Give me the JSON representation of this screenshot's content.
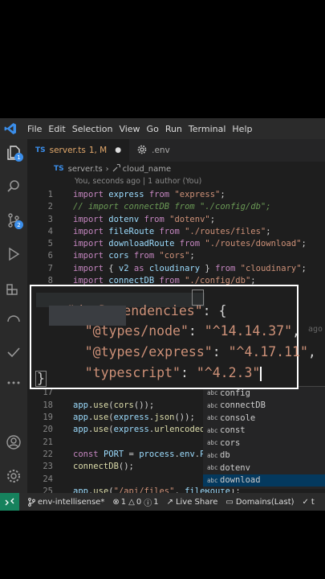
{
  "menubar": {
    "items": [
      "File",
      "Edit",
      "Selection",
      "View",
      "Go",
      "Run",
      "Terminal",
      "Help"
    ]
  },
  "tabs": [
    {
      "icon": "TS",
      "label": "server.ts",
      "status": "1, M"
    },
    {
      "label": ".env"
    }
  ],
  "breadcrumb": {
    "file_icon": "TS",
    "file": "server.ts",
    "symbol": "cloud_name"
  },
  "codelens": "You, seconds ago | 1 author (You)",
  "code_lines": [
    {
      "n": "1",
      "t": [
        [
          "kw",
          "import "
        ],
        [
          "id",
          "express "
        ],
        [
          "kw",
          "from "
        ],
        [
          "str",
          "\"express\""
        ],
        [
          "pl",
          ";"
        ]
      ]
    },
    {
      "n": "2",
      "t": [
        [
          "cm",
          "// import connectDB from \"./config/db\";"
        ]
      ]
    },
    {
      "n": "3",
      "t": [
        [
          "kw",
          "import "
        ],
        [
          "id",
          "dotenv "
        ],
        [
          "kw",
          "from "
        ],
        [
          "str",
          "\"dotenv\""
        ],
        [
          "pl",
          ";"
        ]
      ]
    },
    {
      "n": "4",
      "t": [
        [
          "kw",
          "import "
        ],
        [
          "id",
          "fileRoute "
        ],
        [
          "kw",
          "from "
        ],
        [
          "str",
          "\"./routes/files\""
        ],
        [
          "pl",
          ";"
        ]
      ]
    },
    {
      "n": "5",
      "t": [
        [
          "kw",
          "import "
        ],
        [
          "id",
          "downloadRoute "
        ],
        [
          "kw",
          "from "
        ],
        [
          "str",
          "\"./routes/download\""
        ],
        [
          "pl",
          ";"
        ]
      ]
    },
    {
      "n": "6",
      "t": [
        [
          "kw",
          "import "
        ],
        [
          "id",
          "cors "
        ],
        [
          "kw",
          "from "
        ],
        [
          "str",
          "\"cors\""
        ],
        [
          "pl",
          ";"
        ]
      ]
    },
    {
      "n": "7",
      "t": [
        [
          "kw",
          "import "
        ],
        [
          "pl",
          "{ "
        ],
        [
          "id",
          "v2 "
        ],
        [
          "kw",
          "as "
        ],
        [
          "id",
          "cloudinary "
        ],
        [
          "pl",
          "} "
        ],
        [
          "kw",
          "from "
        ],
        [
          "str",
          "\"cloudinary\""
        ],
        [
          "pl",
          ";"
        ]
      ]
    },
    {
      "n": "8",
      "t": [
        [
          "kw",
          "import "
        ],
        [
          "id",
          "connectDB "
        ],
        [
          "kw",
          "from "
        ],
        [
          "str",
          "\"./config/db\""
        ],
        [
          "pl",
          ";"
        ]
      ]
    },
    {
      "n": "17",
      "t": [
        [
          "pl",
          ""
        ]
      ]
    },
    {
      "n": "18",
      "t": [
        [
          "id",
          "app"
        ],
        [
          "pl",
          "."
        ],
        [
          "fn",
          "use"
        ],
        [
          "pl",
          "("
        ],
        [
          "fn",
          "cors"
        ],
        [
          "pl",
          "());"
        ]
      ]
    },
    {
      "n": "19",
      "t": [
        [
          "id",
          "app"
        ],
        [
          "pl",
          "."
        ],
        [
          "fn",
          "use"
        ],
        [
          "pl",
          "("
        ],
        [
          "id",
          "express"
        ],
        [
          "pl",
          "."
        ],
        [
          "fn",
          "json"
        ],
        [
          "pl",
          "());"
        ]
      ]
    },
    {
      "n": "20",
      "t": [
        [
          "id",
          "app"
        ],
        [
          "pl",
          "."
        ],
        [
          "fn",
          "use"
        ],
        [
          "pl",
          "("
        ],
        [
          "id",
          "express"
        ],
        [
          "pl",
          "."
        ],
        [
          "fn",
          "urlencoded"
        ]
      ]
    },
    {
      "n": "21",
      "t": [
        [
          "pl",
          ""
        ]
      ]
    },
    {
      "n": "22",
      "t": [
        [
          "kw",
          "const "
        ],
        [
          "id",
          "PORT "
        ],
        [
          "pl",
          "= "
        ],
        [
          "id",
          "process"
        ],
        [
          "pl",
          "."
        ],
        [
          "id",
          "env"
        ],
        [
          "pl",
          "."
        ],
        [
          "id",
          "P"
        ]
      ]
    },
    {
      "n": "23",
      "t": [
        [
          "fn",
          "connectDB"
        ],
        [
          "pl",
          "();"
        ]
      ]
    },
    {
      "n": "24",
      "t": [
        [
          "pl",
          ""
        ]
      ]
    },
    {
      "n": "25",
      "t": [
        [
          "id",
          "app"
        ],
        [
          "pl",
          "."
        ],
        [
          "fn",
          "use"
        ],
        [
          "pl",
          "("
        ],
        [
          "str",
          "\"/api/files\""
        ],
        [
          "pl",
          ", "
        ],
        [
          "id",
          "fileRoute"
        ],
        [
          "pl",
          ");"
        ]
      ]
    }
  ],
  "suggestions": [
    {
      "kind": "abc",
      "label": "config"
    },
    {
      "kind": "abc",
      "label": "connectDB"
    },
    {
      "kind": "abc",
      "label": "console"
    },
    {
      "kind": "abc",
      "label": "const"
    },
    {
      "kind": "abc",
      "label": "cors"
    },
    {
      "kind": "abc",
      "label": "db"
    },
    {
      "kind": "abc",
      "label": "dotenv"
    },
    {
      "kind": "abc",
      "label": "download"
    }
  ],
  "zoom_overlay": {
    "key": "\"devDependencies\"",
    "colon_brace": ": {",
    "entries": [
      {
        "name": "\"@types/node\"",
        "version": "\"^14.14.37\"",
        "tail": ","
      },
      {
        "name": "\"@types/express\"",
        "version": "\"^4.17.11\"",
        "tail": ","
      },
      {
        "name": "\"typescript\"",
        "version": "\"^4.2.3\"",
        "tail": ""
      }
    ],
    "close": "}",
    "ghost_text": "ago"
  },
  "statusbar": {
    "branch": "env-intellisense*",
    "errors": "1",
    "warnings": "0",
    "info": "1",
    "live_share": "Live Share",
    "domains": "Domains(Last)",
    "trail": "t"
  },
  "colors": {
    "accent": "#3b8eea",
    "remote": "#16825d",
    "selection": "#04395e"
  }
}
